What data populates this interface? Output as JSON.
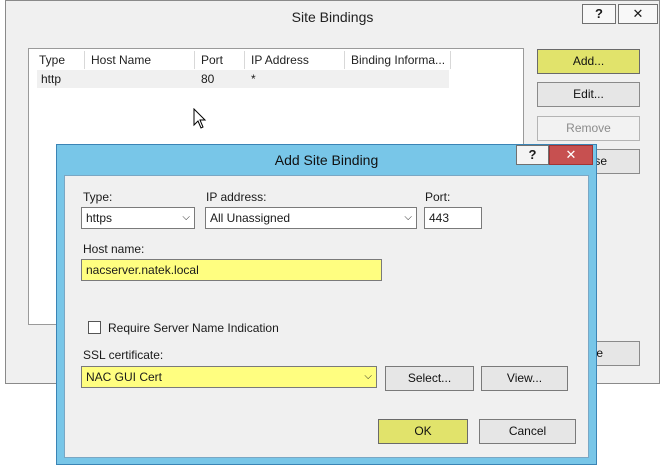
{
  "site_bindings": {
    "title": "Site Bindings",
    "help_label": "?",
    "close_label": "✕",
    "columns": [
      "Type",
      "Host Name",
      "Port",
      "IP Address",
      "Binding Informa..."
    ],
    "rows": [
      {
        "type": "http",
        "host": "",
        "port": "80",
        "ip": "*",
        "binding_info": ""
      }
    ],
    "buttons": {
      "add": "Add...",
      "edit": "Edit...",
      "remove": "Remove",
      "browse": "se",
      "close": "e"
    }
  },
  "dialog": {
    "title": "Add Site Binding",
    "help_label": "?",
    "close_label": "✕",
    "type_label": "Type:",
    "type_value": "https",
    "ip_label": "IP address:",
    "ip_value": "All Unassigned",
    "port_label": "Port:",
    "port_value": "443",
    "host_label": "Host name:",
    "host_value": "nacserver.natek.local",
    "sni_label": "Require Server Name Indication",
    "sni_checked": false,
    "ssl_label": "SSL certificate:",
    "ssl_value": "NAC GUI Cert",
    "select_label": "Select...",
    "view_label": "View...",
    "ok_label": "OK",
    "cancel_label": "Cancel"
  },
  "colors": {
    "dialog_frame": "#78c6e8",
    "highlight": "#fffe80",
    "close_red": "#c75050",
    "default_button": "#e1e36b"
  }
}
